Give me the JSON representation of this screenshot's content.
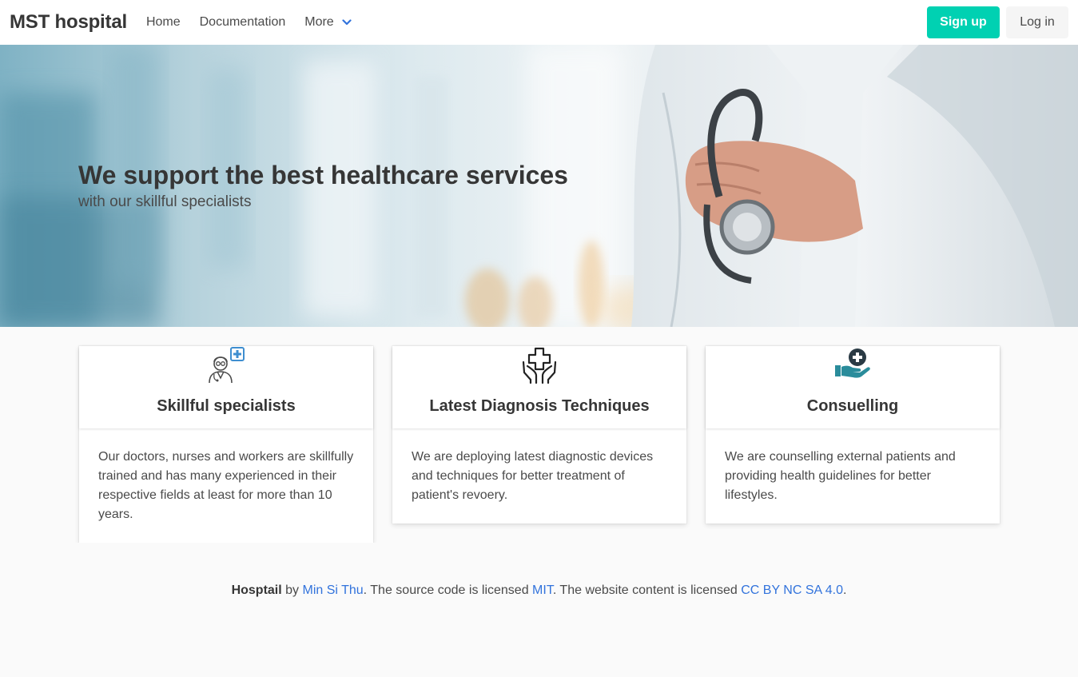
{
  "navbar": {
    "brand": "MST hospital",
    "links": {
      "home": "Home",
      "documentation": "Documentation",
      "more": "More"
    },
    "signup_label": "Sign up",
    "login_label": "Log in"
  },
  "hero": {
    "title": "We support the best healthcare services",
    "subtitle": "with our skillful specialists"
  },
  "cards": [
    {
      "icon": "doctor-icon",
      "title": "Skillful specialists",
      "body": "Our doctors, nurses and workers are skillfully trained and has many experienced in their respective fields at least for more than 10 years."
    },
    {
      "icon": "hands-cross-icon",
      "title": "Latest Diagnosis Techniques",
      "body": "We are deploying latest diagnostic devices and techniques for better treatment of patient's revoery."
    },
    {
      "icon": "hand-plus-icon",
      "title": "Consuelling",
      "body": "We are counselling external patients and providing health guidelines for better lifestyles."
    }
  ],
  "footer": {
    "project": "Hosptail",
    "by": " by ",
    "author": "Min Si Thu",
    "source_text": ". The source code is licensed ",
    "source_license": "MIT",
    "content_text": ". The website content is licensed ",
    "content_license": "CC BY NC SA 4.0",
    "end": "."
  },
  "colors": {
    "primary": "#00d1b2",
    "link": "#3273dc",
    "icon_blue": "#3e8ed0",
    "icon_teal": "#2a8c9b"
  }
}
